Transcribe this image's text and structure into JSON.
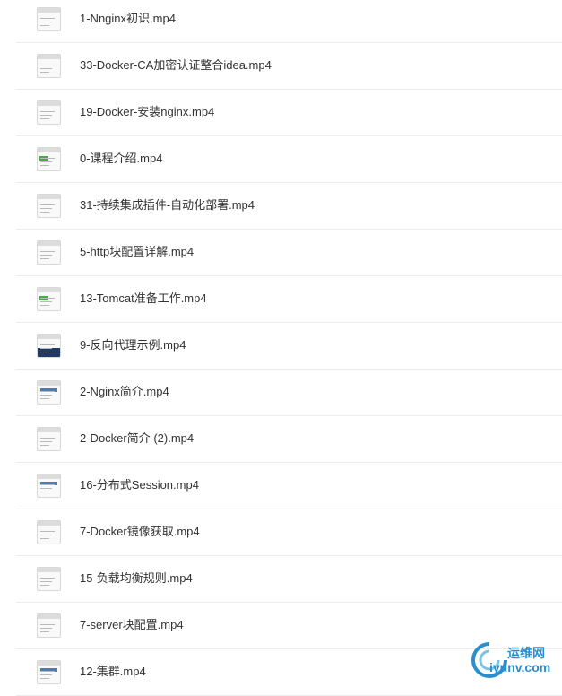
{
  "files": [
    {
      "name": "1-Nnginx初识.mp4",
      "thumb": "doc"
    },
    {
      "name": "33-Docker-CA加密认证整合idea.mp4",
      "thumb": "app"
    },
    {
      "name": "19-Docker-安装nginx.mp4",
      "thumb": "app"
    },
    {
      "name": "0-课程介绍.mp4",
      "thumb": "green"
    },
    {
      "name": "31-持续集成插件-自动化部署.mp4",
      "thumb": "doc"
    },
    {
      "name": "5-http块配置详解.mp4",
      "thumb": "doc"
    },
    {
      "name": "13-Tomcat准备工作.mp4",
      "thumb": "green"
    },
    {
      "name": "9-反向代理示例.mp4",
      "thumb": "dark"
    },
    {
      "name": "2-Nginx简介.mp4",
      "thumb": "blue"
    },
    {
      "name": "2-Docker简介 (2).mp4",
      "thumb": "doc"
    },
    {
      "name": "16-分布式Session.mp4",
      "thumb": "blue"
    },
    {
      "name": "7-Docker镜像获取.mp4",
      "thumb": "doc"
    },
    {
      "name": "15-负载均衡规则.mp4",
      "thumb": "doc"
    },
    {
      "name": "7-server块配置.mp4",
      "thumb": "doc"
    },
    {
      "name": "12-集群.mp4",
      "thumb": "blue"
    }
  ],
  "watermark": {
    "top": "运维网",
    "bottom": "iyunv.com"
  },
  "colors": {
    "text": "#333333",
    "divider": "#ececec",
    "watermark": "#2a8fce"
  }
}
